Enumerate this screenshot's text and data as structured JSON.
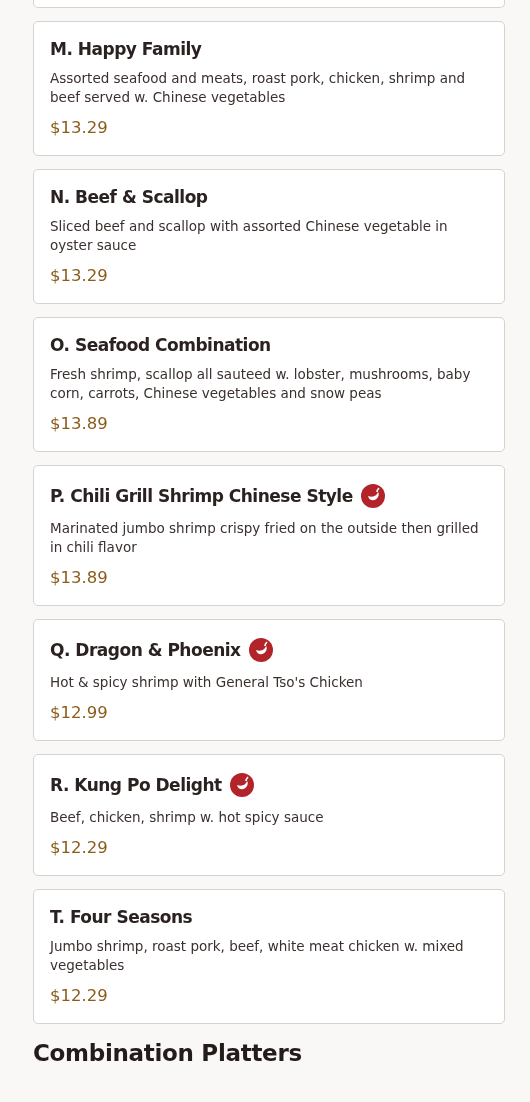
{
  "items": [
    {
      "title": "M. Happy Family",
      "spicy": false,
      "description": "Assorted seafood and meats, roast pork, chicken, shrimp and beef served w. Chinese vegetables",
      "price": "$13.29"
    },
    {
      "title": "N. Beef & Scallop",
      "spicy": false,
      "description": "Sliced beef and scallop with assorted Chinese vegetable in oyster sauce",
      "price": "$13.29"
    },
    {
      "title": "O. Seafood Combination",
      "spicy": false,
      "description": "Fresh shrimp, scallop all sauteed w. lobster, mushrooms, baby corn, carrots, Chinese vegetables and snow peas",
      "price": "$13.89"
    },
    {
      "title": "P. Chili Grill Shrimp Chinese Style",
      "spicy": true,
      "description": "Marinated jumbo shrimp crispy fried on the outside then grilled in chili flavor",
      "price": "$13.89"
    },
    {
      "title": "Q. Dragon & Phoenix",
      "spicy": true,
      "description": "Hot & spicy shrimp with General Tso's Chicken",
      "price": "$12.99"
    },
    {
      "title": "R. Kung Po Delight",
      "spicy": true,
      "description": "Beef, chicken, shrimp w. hot spicy sauce",
      "price": "$12.29"
    },
    {
      "title": "T. Four Seasons",
      "spicy": false,
      "description": "Jumbo shrimp, roast pork, beef, white meat chicken w. mixed vegetables",
      "price": "$12.29"
    }
  ],
  "next_section": {
    "heading": "Combination Platters"
  }
}
